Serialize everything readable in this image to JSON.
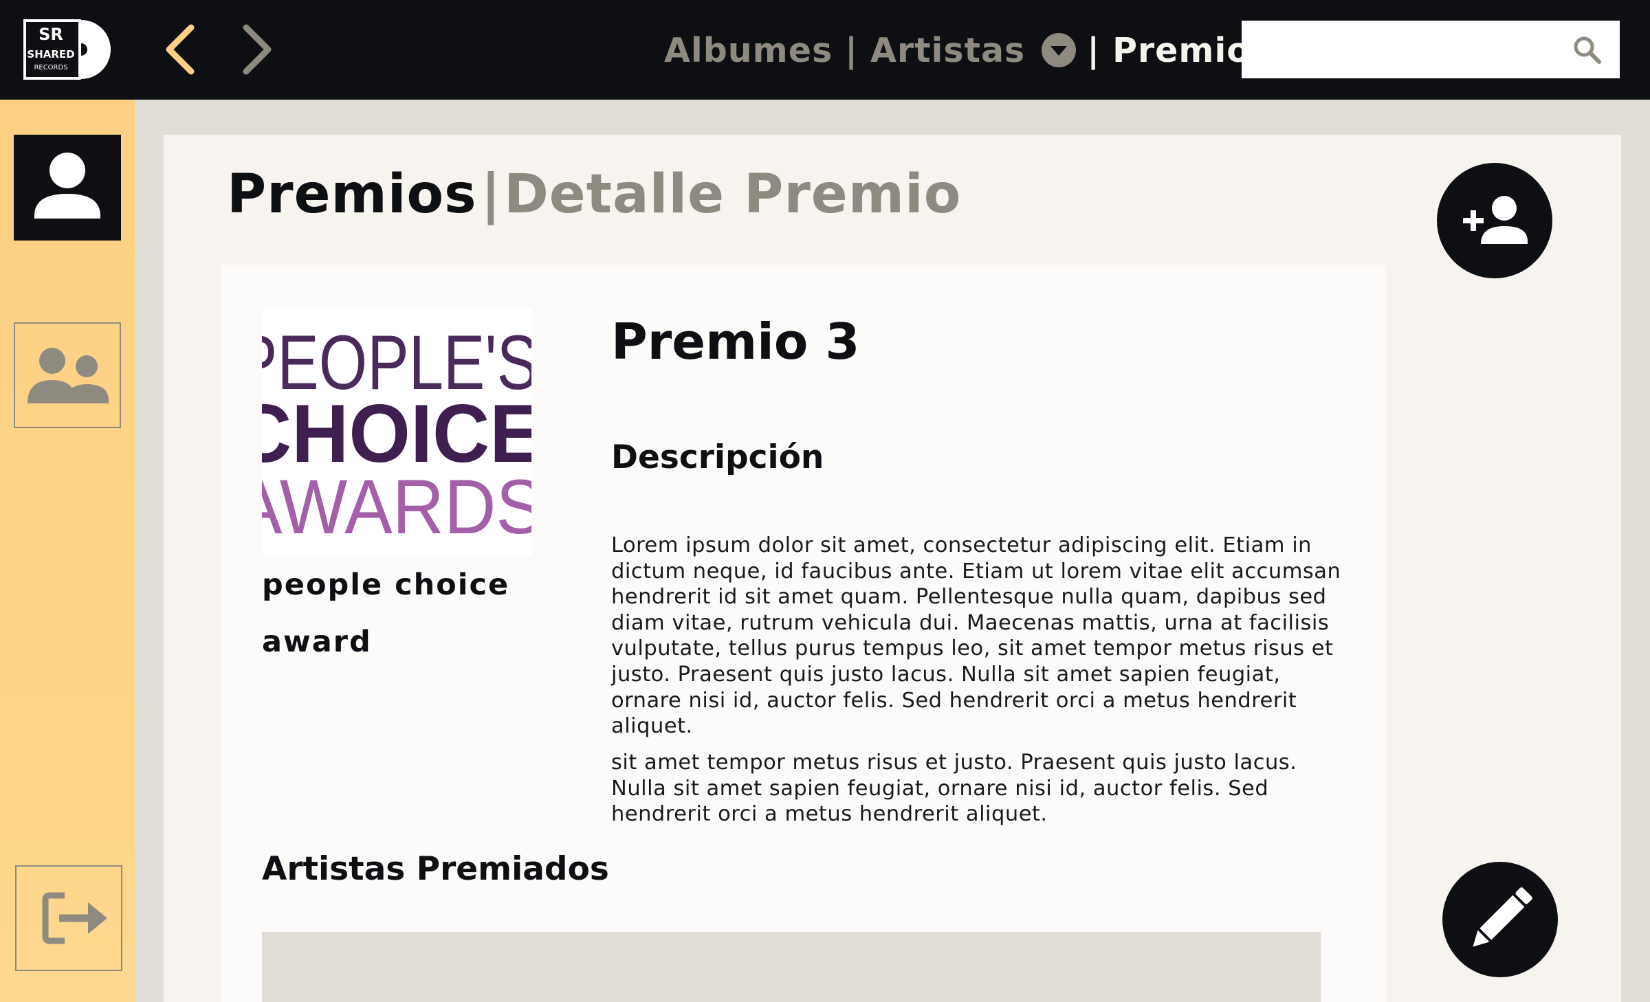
{
  "app": {
    "logo_text_top": "SR",
    "logo_text_mid": "SHARED",
    "logo_text_bottom": "RECORDS"
  },
  "topnav": {
    "albums_label": "Albumes",
    "separator": "|",
    "artists_label": "Artistas",
    "awards_label": "Premios",
    "trailing_separator": "|"
  },
  "search": {
    "placeholder": "",
    "value": ""
  },
  "page": {
    "title": "Premios",
    "title_separator": "|",
    "subtitle": "Detalle Premio"
  },
  "award": {
    "logo_line1": "PEOPLE'S",
    "logo_line2": "CHOICE",
    "logo_line3": "AWARDS",
    "name": "people choice award",
    "title": "Premio 3",
    "description_heading": "Descripción",
    "description_p1": "Lorem ipsum dolor sit amet, consectetur adipiscing elit. Etiam in dictum neque, id faucibus ante. Etiam ut lorem vitae elit accumsan hendrerit id sit amet quam. Pellentesque nulla quam, dapibus sed diam vitae, rutrum vehicula dui. Maecenas mattis, urna at facilisis vulputate, tellus purus tempus leo, sit amet tempor metus risus et justo. Praesent quis justo lacus. Nulla sit amet sapien feugiat, ornare nisi id, auctor felis. Sed hendrerit orci a metus hendrerit aliquet.",
    "description_p2": "sit amet tempor metus risus et justo. Praesent quis justo lacus. Nulla sit amet sapien feugiat, ornare nisi id, auctor felis. Sed hendrerit orci a metus hendrerit aliquet.",
    "artists_heading": "Artistas Premiados"
  },
  "icons": {
    "back": "chevron-left-icon",
    "forward": "chevron-right-icon",
    "search": "search-icon",
    "user": "user-icon",
    "group": "group-icon",
    "logout": "logout-icon",
    "add_user": "add-user-icon",
    "edit": "pencil-icon"
  },
  "colors": {
    "topbar": "#0d0f13",
    "sidebar": "#fdd083",
    "accent_yellow": "#fdd083",
    "muted": "#8f8a80",
    "panel": "#f7f3ee",
    "logo_purple": "#4a2a5a",
    "logo_pink": "#a35fa8"
  }
}
